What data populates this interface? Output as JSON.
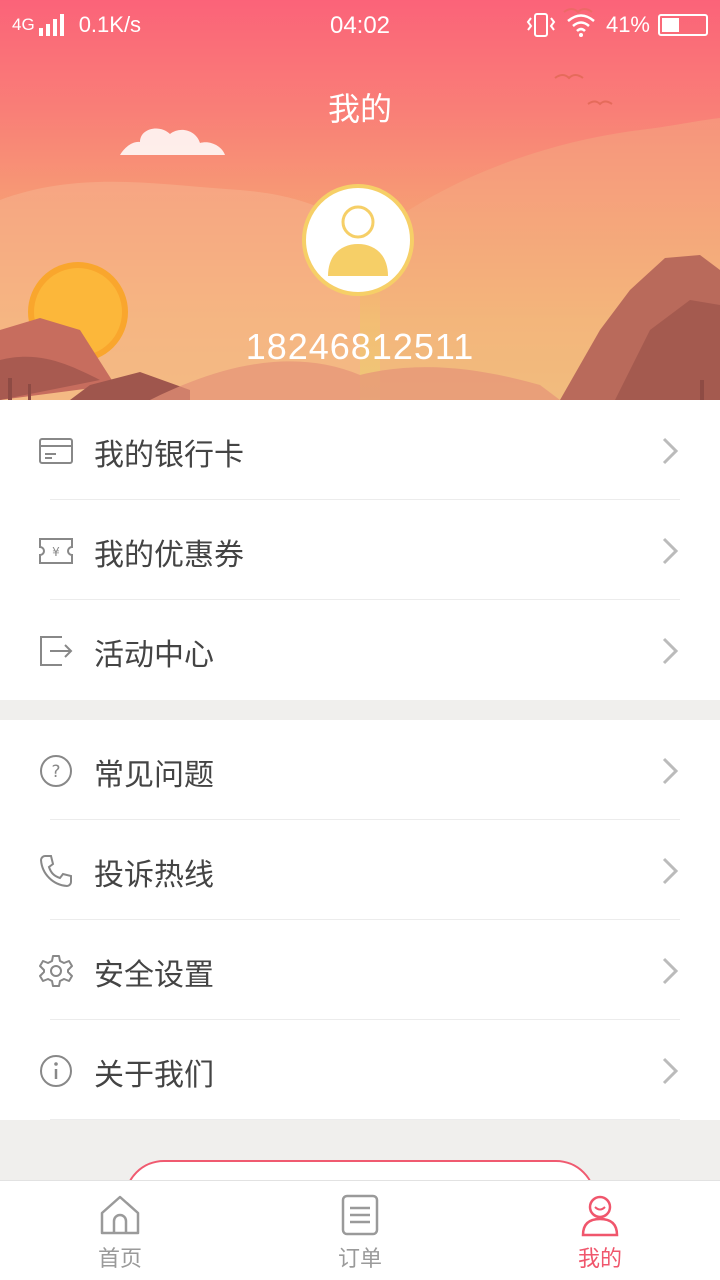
{
  "status_bar": {
    "network": "4G",
    "speed": "0.1K/s",
    "time": "04:02",
    "battery": "41%",
    "battery_level": 0.41
  },
  "header": {
    "title": "我的",
    "phone": "18246812511"
  },
  "menu_group_1": [
    {
      "label": "我的银行卡",
      "icon": "bank-card-icon"
    },
    {
      "label": "我的优惠券",
      "icon": "coupon-icon"
    },
    {
      "label": "活动中心",
      "icon": "activity-icon"
    }
  ],
  "menu_group_2": [
    {
      "label": "常见问题",
      "icon": "question-icon"
    },
    {
      "label": "投诉热线",
      "icon": "phone-icon"
    },
    {
      "label": "安全设置",
      "icon": "settings-icon"
    },
    {
      "label": "关于我们",
      "icon": "info-icon"
    }
  ],
  "tabs": [
    {
      "label": "首页",
      "icon": "home-icon",
      "active": false
    },
    {
      "label": "订单",
      "icon": "order-icon",
      "active": false
    },
    {
      "label": "我的",
      "icon": "user-icon",
      "active": true
    }
  ],
  "colors": {
    "accent": "#f0566c",
    "avatar_ring": "#f6cf67",
    "header_top": "#fb6379",
    "header_bottom": "#efc878"
  }
}
